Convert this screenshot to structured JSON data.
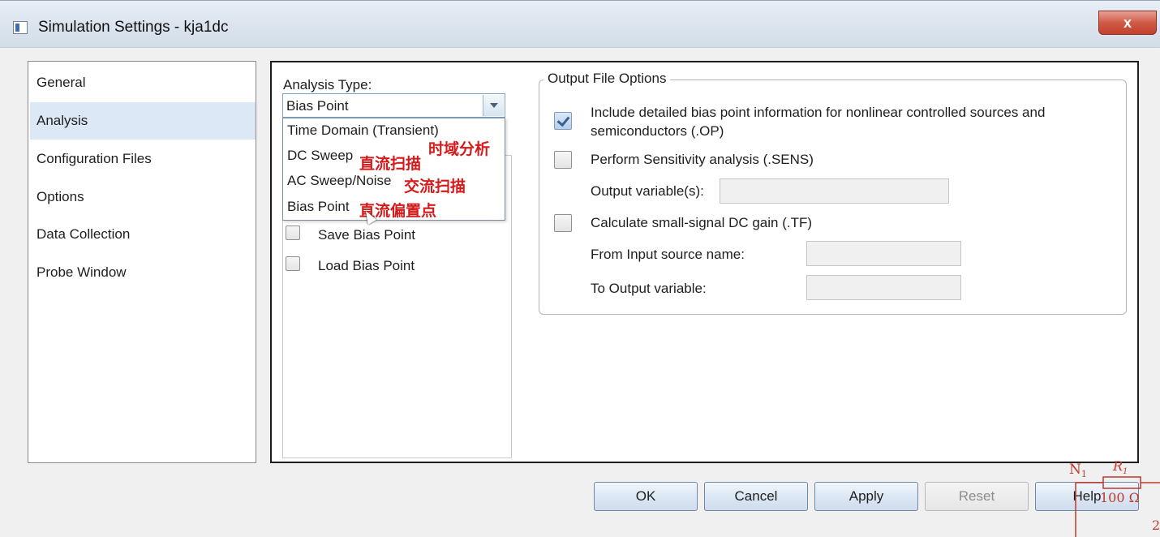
{
  "window": {
    "title": "Simulation Settings - kja1dc",
    "close_label": "x"
  },
  "nav": {
    "items": [
      {
        "label": "General"
      },
      {
        "label": "Analysis",
        "selected": true
      },
      {
        "label": "Configuration Files"
      },
      {
        "label": "Options"
      },
      {
        "label": "Data Collection"
      },
      {
        "label": "Probe Window"
      }
    ]
  },
  "analysis": {
    "type_label": "Analysis Type:",
    "selected_value": "Bias Point",
    "options": [
      {
        "label": "Time Domain (Transient)"
      },
      {
        "label": "DC Sweep"
      },
      {
        "label": "AC Sweep/Noise"
      },
      {
        "label": "Bias Point"
      }
    ],
    "annotations": {
      "time_domain": "时域分析",
      "dc_sweep": "直流扫描",
      "ac_sweep": "交流扫描",
      "bias_point": "直流偏置点"
    },
    "save_bias_point": {
      "label": "Save Bias Point",
      "checked": false
    },
    "load_bias_point": {
      "label": "Load Bias Point",
      "checked": false
    }
  },
  "output": {
    "title": "Output File Options",
    "op": {
      "line1": "Include detailed bias point information for nonlinear controlled sources and",
      "line2": "semiconductors (.OP)",
      "checked": true
    },
    "sens": {
      "label": "Perform Sensitivity analysis (.SENS)",
      "checked": false
    },
    "output_vars": {
      "label": "Output variable(s):",
      "value": ""
    },
    "tf": {
      "label": "Calculate small-signal DC gain (.TF)",
      "checked": false
    },
    "from_input": {
      "label": "From Input source name:",
      "value": ""
    },
    "to_output": {
      "label": "To Output variable:",
      "value": ""
    }
  },
  "buttons": {
    "ok": "OK",
    "cancel": "Cancel",
    "apply": "Apply",
    "reset": "Reset",
    "help": "Help"
  },
  "circuit_overlay": {
    "node": "N",
    "node_sub": "1",
    "resistor": "R",
    "resistor_sub": "1",
    "value": "100 Ω",
    "pin": "2"
  }
}
